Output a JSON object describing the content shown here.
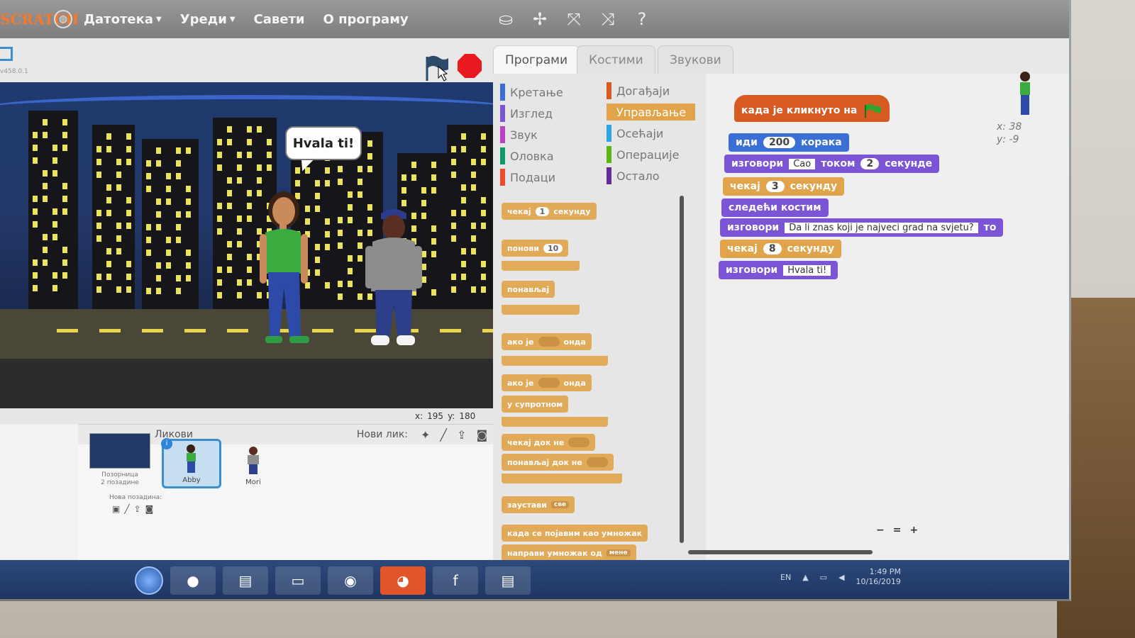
{
  "menubar": {
    "logo": "SCRATCH",
    "items": [
      {
        "label": "Датотека",
        "has_caret": true
      },
      {
        "label": "Уреди",
        "has_caret": true
      },
      {
        "label": "Савети",
        "has_caret": false
      },
      {
        "label": "О програму",
        "has_caret": false
      }
    ],
    "tools": [
      "duplicate-icon",
      "delete-icon",
      "grow-icon",
      "shrink-icon",
      "help-icon"
    ]
  },
  "stage_header": {
    "version": "v458.0.1"
  },
  "stage": {
    "speech": "Hvala ti!",
    "coords": {
      "x_label": "x:",
      "x": "195",
      "y_label": "y:",
      "y": "180"
    }
  },
  "sprite_pane": {
    "title": "Ликови",
    "new_sprite_label": "Нови лик:",
    "stage_label_1": "Позорница",
    "stage_label_2": "2 позадине",
    "new_backdrop_label": "Нова позадина:",
    "sprites": [
      {
        "name": "Abby",
        "selected": true
      },
      {
        "name": "Mori",
        "selected": false
      }
    ]
  },
  "tabs": [
    {
      "label": "Програми",
      "active": true
    },
    {
      "label": "Костими",
      "active": false
    },
    {
      "label": "Звукови",
      "active": false
    }
  ],
  "categories": {
    "left": [
      {
        "label": "Кретање",
        "color": "#3a70d6"
      },
      {
        "label": "Изглед",
        "color": "#7c55d6"
      },
      {
        "label": "Звук",
        "color": "#bb42c3"
      },
      {
        "label": "Оловка",
        "color": "#0e9a6c"
      },
      {
        "label": "Подаци",
        "color": "#ee4d2d"
      }
    ],
    "right": [
      {
        "label": "Догађаји",
        "color": "#d65a22",
        "active": false
      },
      {
        "label": "Управљање",
        "color": "#e1a44a",
        "active": true
      },
      {
        "label": "Осећаји",
        "color": "#2ca5e2",
        "active": false
      },
      {
        "label": "Операције",
        "color": "#5cb712",
        "active": false
      },
      {
        "label": "Остало",
        "color": "#632d99",
        "active": false
      }
    ]
  },
  "palette_blocks": {
    "wait_label": "чекај",
    "wait_num": "1",
    "wait_unit": "секунду",
    "repeat_label": "понови",
    "repeat_num": "10",
    "forever_label": "понављај",
    "if_label": "ако је",
    "then_label": "онда",
    "else_label": "у супротном",
    "wait_until_label": "чекај док не",
    "repeat_until_label": "понављај док не",
    "stop_label": "заустави",
    "stop_opt": "све",
    "clone_start_label": "када се појавим као умножак",
    "create_clone_label": "направи умножак од",
    "create_clone_opt": "мене"
  },
  "script": {
    "hat_label": "када је кликнуто на",
    "move_label": "иди",
    "move_num": "200",
    "move_unit": "корака",
    "say1_label": "изговори",
    "say1_text": "Cao",
    "say1_for": "током",
    "say1_num": "2",
    "say1_unit": "секунде",
    "wait1_label": "чекај",
    "wait1_num": "3",
    "wait1_unit": "секунду",
    "next_costume_label": "следећи костим",
    "say2_label": "изговори",
    "say2_text": "Da li znas koji je najveci grad na svjetu?",
    "say2_tail": "то",
    "wait2_label": "чекај",
    "wait2_num": "8",
    "wait2_unit": "секунду",
    "say3_label": "изговори",
    "say3_text": "Hvala ti!"
  },
  "sprite_info": {
    "x": "x: 38",
    "y": "y: -9"
  },
  "taskbar": {
    "lang": "EN",
    "time": "1:49 PM",
    "date": "10/16/2019"
  }
}
